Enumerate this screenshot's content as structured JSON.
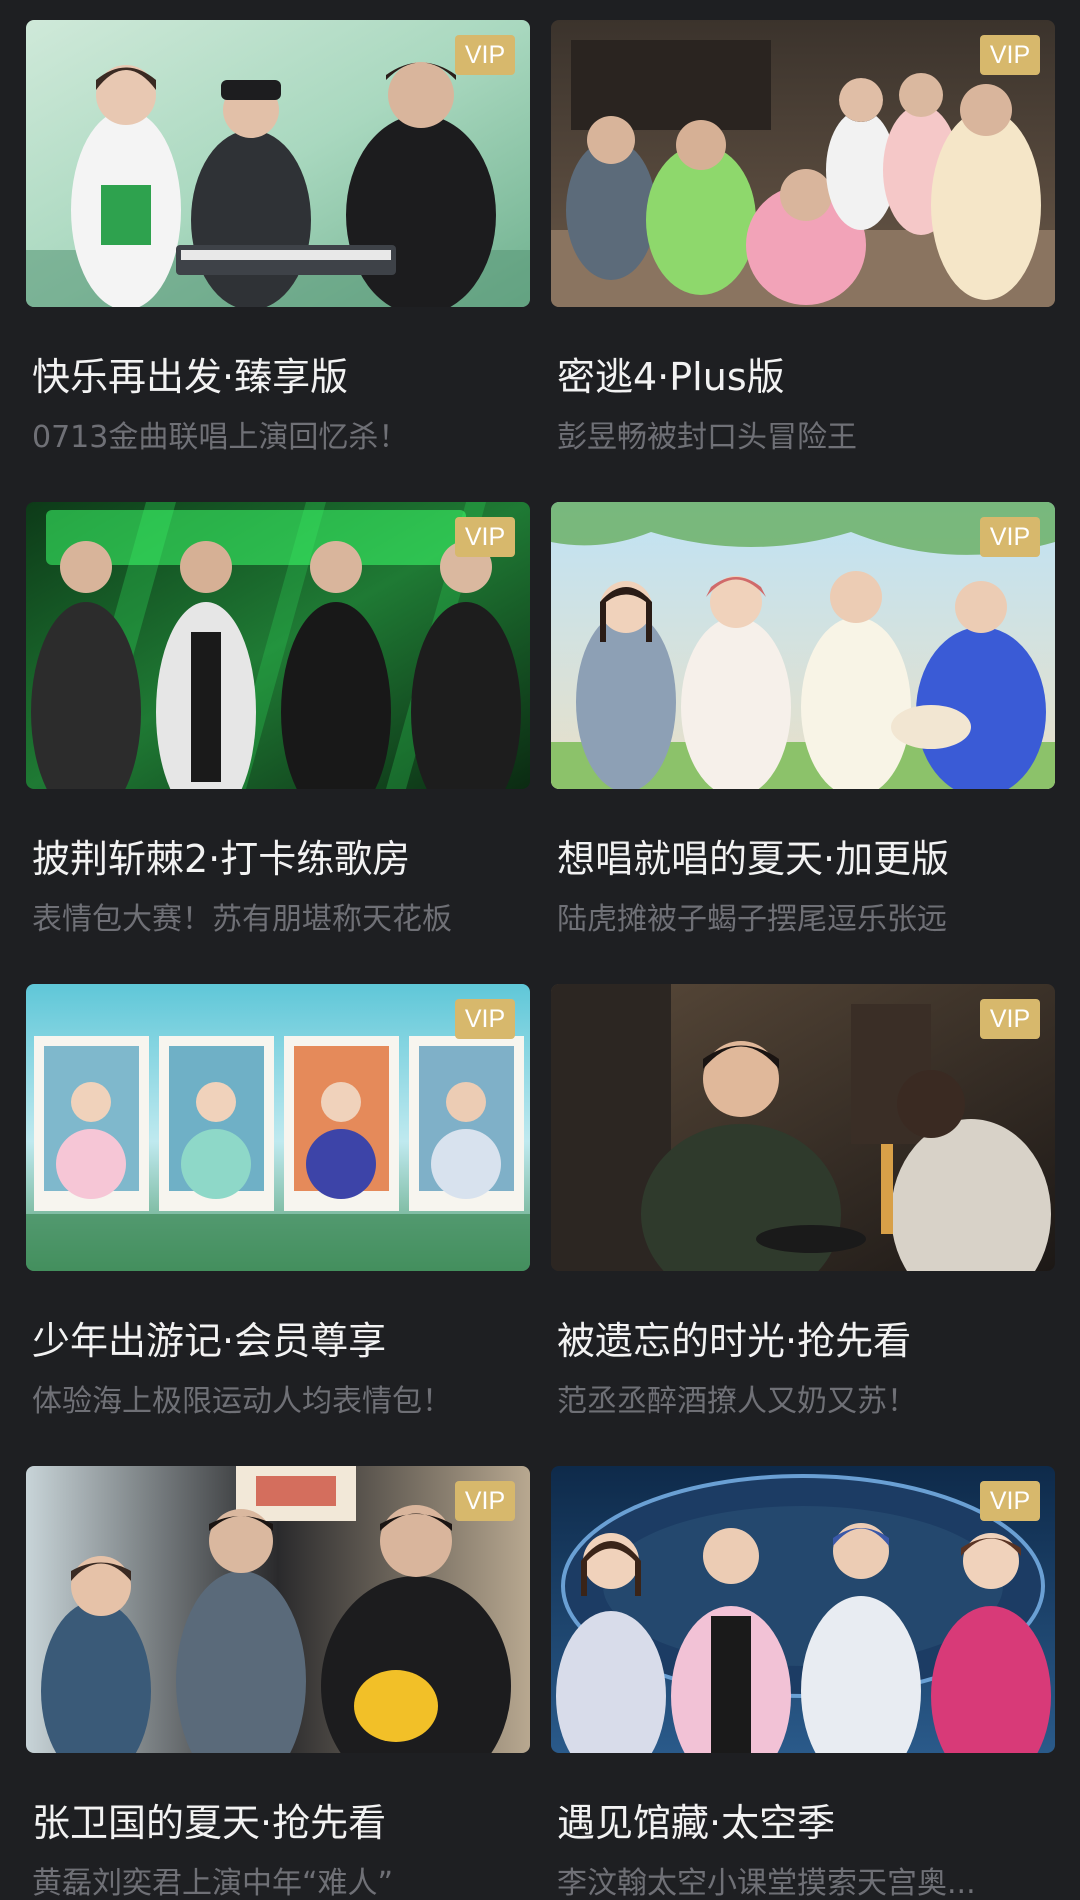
{
  "vip_label": "VIP",
  "colors": {
    "background": "#1e1f22",
    "vip_badge": "#d7b86c",
    "title": "#f2f2f2",
    "subtitle": "#6f7076"
  },
  "cards": [
    {
      "title": "快乐再出发·臻享版",
      "subtitle": "0713金曲联唱上演回忆杀！"
    },
    {
      "title": "密逃4·Plus版",
      "subtitle": "彭昱畅被封口头冒险王"
    },
    {
      "title": "披荆斩棘2·打卡练歌房",
      "subtitle": "表情包大赛！苏有朋堪称天花板"
    },
    {
      "title": "想唱就唱的夏天·加更版",
      "subtitle": "陆虎摊被子蝎子摆尾逗乐张远"
    },
    {
      "title": "少年出游记·会员尊享",
      "subtitle": "体验海上极限运动人均表情包！"
    },
    {
      "title": "被遗忘的时光·抢先看",
      "subtitle": "范丞丞醉酒撩人又奶又苏！"
    },
    {
      "title": "张卫国的夏天·抢先看",
      "subtitle": "黄磊刘奕君上演中年“难人”"
    },
    {
      "title": "遇见馆藏·太空季",
      "subtitle": "李汶翰太空小课堂摸索天宫奥..."
    }
  ]
}
